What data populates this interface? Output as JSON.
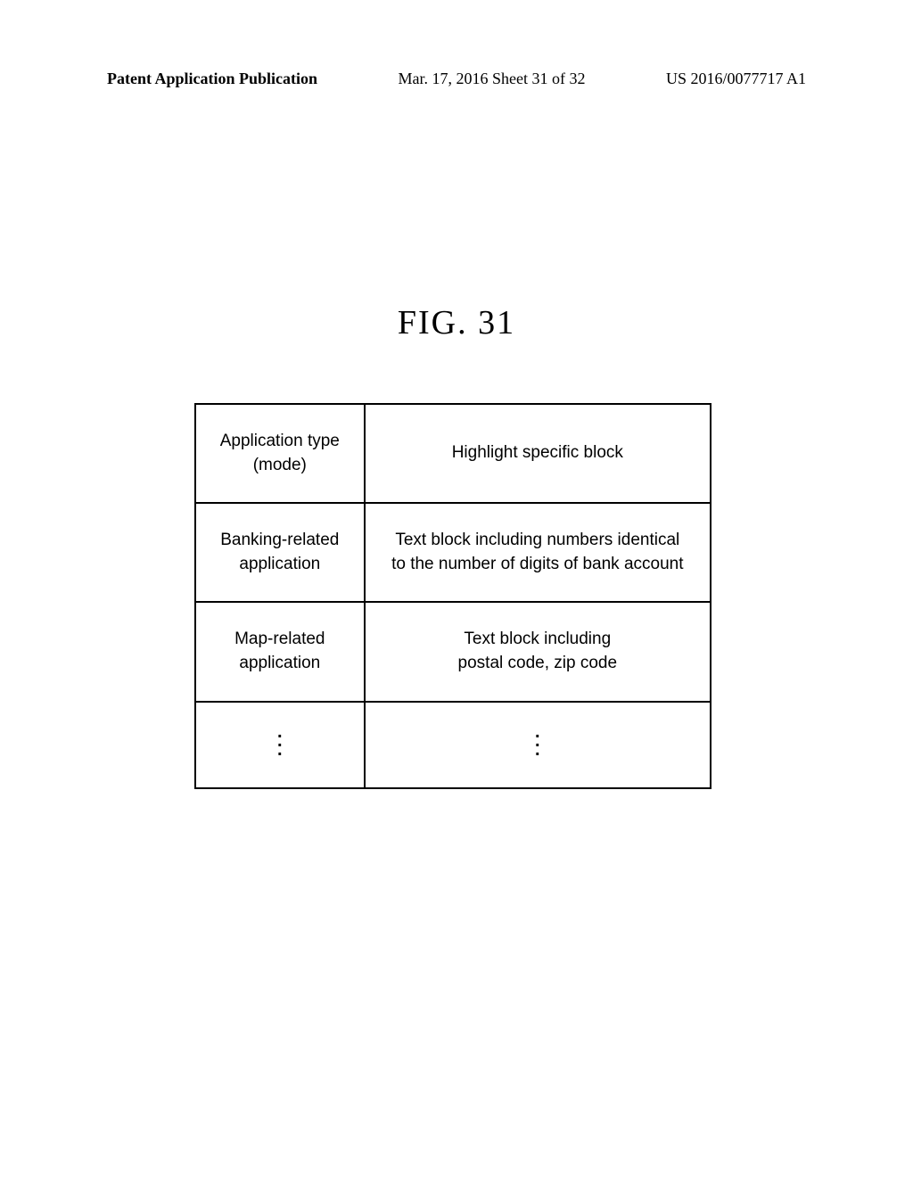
{
  "header": {
    "left": "Patent Application Publication",
    "center": "Mar. 17, 2016  Sheet 31 of 32",
    "right": "US 2016/0077717 A1"
  },
  "figure": {
    "title": "FIG. 31"
  },
  "table": {
    "header": {
      "col1_line1": "Application type",
      "col1_line2": "(mode)",
      "col2": "Highlight specific block"
    },
    "rows": [
      {
        "col1_line1": "Banking-related",
        "col1_line2": "application",
        "col2_line1": "Text block including numbers identical",
        "col2_line2": "to the number of digits of bank account"
      },
      {
        "col1_line1": "Map-related",
        "col1_line2": "application",
        "col2_line1": "Text block including",
        "col2_line2": "postal code, zip code"
      }
    ]
  }
}
